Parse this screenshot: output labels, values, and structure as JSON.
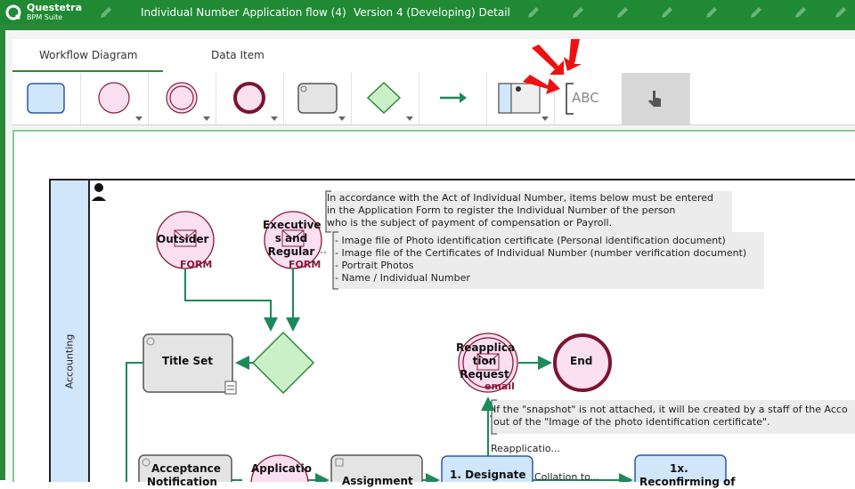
{
  "app": {
    "brand_name": "Questetra",
    "brand_sub": "BPM Suite",
    "title": "Individual Number Application flow (4)",
    "version": "Version 4 (Developing) Detail"
  },
  "tabs": [
    {
      "label": "Workflow Diagram",
      "active": true
    },
    {
      "label": "Data Item",
      "active": false
    }
  ],
  "palette": {
    "items": [
      "task-icon",
      "start-event-icon",
      "intermediate-event-icon",
      "end-event-icon",
      "service-task-icon",
      "gateway-icon",
      "sequence-flow-icon",
      "swimlane-icon",
      "annotation-icon",
      "hand-pointer-icon"
    ],
    "annotation_text": "ABC"
  },
  "diagram": {
    "swimlane": "Accounting",
    "events": {
      "outsider": {
        "label": "Outsider",
        "tag": "FORM"
      },
      "executive": {
        "label_lines": [
          "Executive",
          "s and",
          "Regular"
        ],
        "tag": "FORM"
      },
      "reapplication": {
        "label_lines": [
          "Reapplica",
          "tion",
          "Request"
        ],
        "tag": "email"
      },
      "end": {
        "label": "End"
      },
      "application": {
        "label": "Applicatio"
      }
    },
    "tasks": {
      "title_set": "Title Set",
      "acceptance": "Acceptance",
      "acceptance_2": "Notification",
      "assignment": "Assignment",
      "designate": "1. Designate",
      "reconfirm": "1x.",
      "reconfirm_2": "Reconfirming of"
    },
    "notes": {
      "main_lines": [
        "In accordance with the Act of Individual Number, items below must be entered",
        "in the Application Form to register the Individual Number of the person",
        "who is the subject of payment of compensation or Payroll."
      ],
      "list_lines": [
        "- Image file of Photo identification certificate (Personal identification document)",
        "- Image file of the Certificates of Individual Number (number verification document)",
        "- Portrait Photos",
        "- Name / Individual Number"
      ],
      "snapshot_lines": [
        "If the \"snapshot\" is not attached, it will be created by a staff of the Acco",
        "out of the \"Image of the photo identification certificate\"."
      ]
    },
    "flow_labels": {
      "reapplication": "Reapplicatio...",
      "collation": "Collation to..."
    }
  },
  "colors": {
    "brand_green": "#1f8a33",
    "flow_green": "#1c8a5a",
    "event_fill": "#f9dff0",
    "event_stroke": "#8a1a3c",
    "task_blue": "#cfe6fb",
    "task_gray": "#e4e4e4",
    "gateway": "#cbf0c8",
    "callout_red": "#ee1111"
  }
}
